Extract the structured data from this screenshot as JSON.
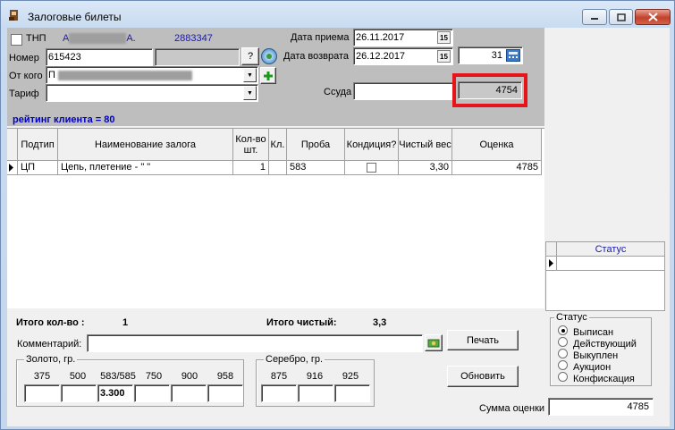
{
  "window": {
    "title": "Залоговые билеты"
  },
  "header": {
    "tnp_label": "ТНП",
    "client_name_suffix": "А.",
    "client_name_prefix": "А",
    "client_phone": "2883347",
    "number_label": "Номер",
    "number_value": "615423",
    "from_label": "От кого",
    "from_value": "П",
    "tariff_label": "Тариф",
    "tariff_value": "",
    "question_button": "?",
    "date_received_label": "Дата приема",
    "date_received_value": "26.11.2017",
    "date_return_label": "Дата возврата",
    "date_return_value": "26.12.2017",
    "days_value": "31",
    "loan_label": "Ссуда",
    "loan_value": "",
    "loan_total": "4754",
    "rating_text": "рейтинг клиента = 80"
  },
  "table": {
    "columns": [
      "Подтип",
      "Наименование залога",
      "Кол-во шт.",
      "Кл.",
      "Проба",
      "Кондиция?",
      "Чистый вес",
      "Оценка"
    ],
    "rows": [
      {
        "subtype": "ЦП",
        "name": "Цепь, плетение - \" \"",
        "qty": "1",
        "cl": "",
        "proba": "583",
        "condition": false,
        "net_weight": "3,30",
        "estimate": "4785"
      }
    ]
  },
  "status_table": {
    "header": "Статус"
  },
  "totals": {
    "qty_label": "Итого кол-во :",
    "qty_value": "1",
    "net_label": "Итого чистый:",
    "net_value": "3,3"
  },
  "comment": {
    "label": "Комментарий:",
    "value": ""
  },
  "buttons": {
    "print": "Печать",
    "refresh": "Обновить"
  },
  "gold": {
    "title": "Золото, гр.",
    "probes": [
      "375",
      "500",
      "583/585",
      "750",
      "900",
      "958"
    ],
    "values": [
      "",
      "",
      "3.300",
      "",
      "",
      ""
    ]
  },
  "silver": {
    "title": "Серебро, гр.",
    "probes": [
      "875",
      "916",
      "925"
    ],
    "values": [
      "",
      "",
      ""
    ]
  },
  "status_group": {
    "title": "Статус",
    "options": [
      "Выписан",
      "Действующий",
      "Выкуплен",
      "Аукцион",
      "Конфискация"
    ],
    "selected": "Выписан"
  },
  "sum": {
    "label": "Сумма оценки",
    "value": "4785"
  },
  "colors": {
    "highlight": "#e8141c",
    "rating": "#0000c0",
    "phone": "#1a1aa6"
  }
}
